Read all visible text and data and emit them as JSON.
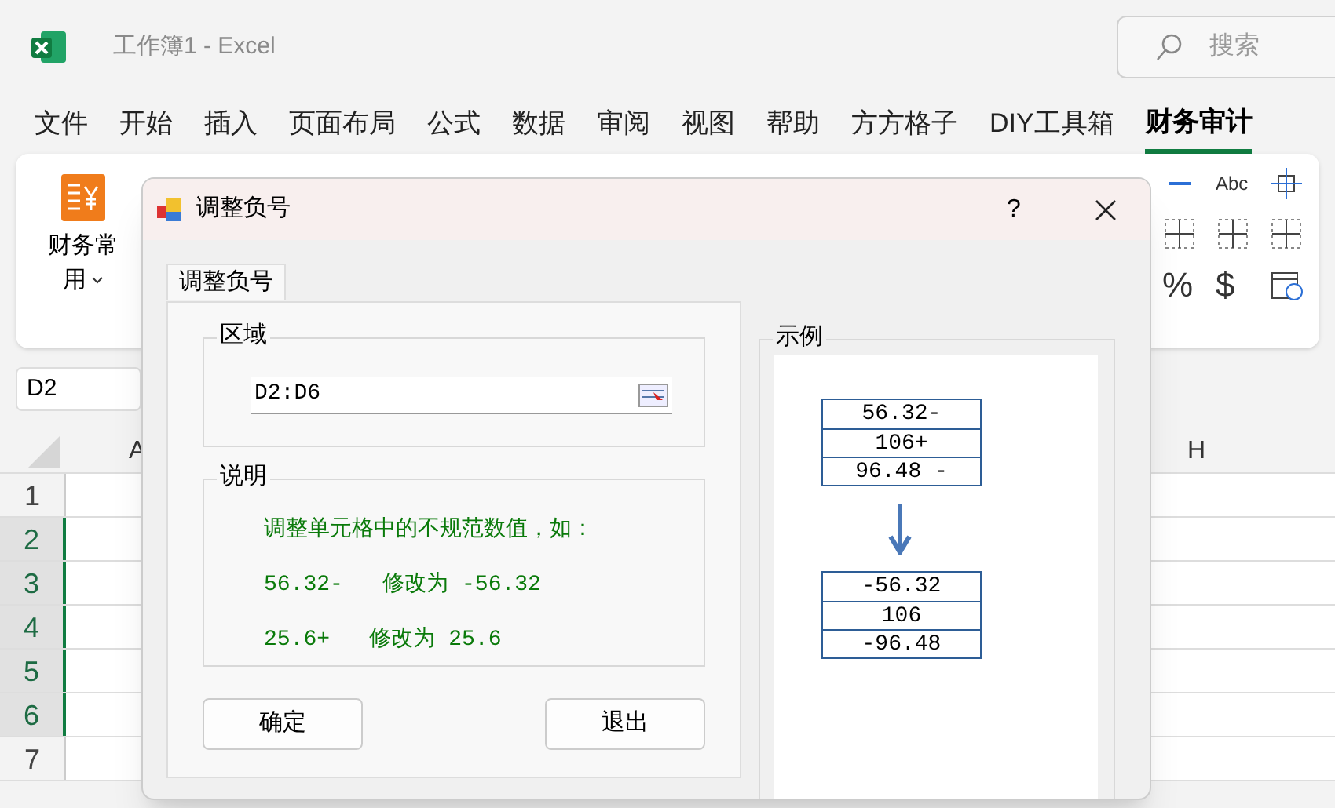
{
  "app": {
    "title": "工作簿1  -  Excel",
    "search_placeholder": "搜索"
  },
  "menu_tabs": [
    {
      "label": "文件",
      "selected": false
    },
    {
      "label": "开始",
      "selected": false
    },
    {
      "label": "插入",
      "selected": false
    },
    {
      "label": "页面布局",
      "selected": false
    },
    {
      "label": "公式",
      "selected": false
    },
    {
      "label": "数据",
      "selected": false
    },
    {
      "label": "审阅",
      "selected": false
    },
    {
      "label": "视图",
      "selected": false
    },
    {
      "label": "帮助",
      "selected": false
    },
    {
      "label": "方方格子",
      "selected": false
    },
    {
      "label": "DIY工具箱",
      "selected": false
    },
    {
      "label": "财务审计",
      "selected": true
    }
  ],
  "ribbon": {
    "main_button": "财务常用",
    "symbols": [
      "Abc",
      "%",
      "$"
    ]
  },
  "name_box": "D2",
  "columns": [
    "A",
    "H"
  ],
  "rows": [
    {
      "label": "1",
      "selected": false
    },
    {
      "label": "2",
      "selected": true
    },
    {
      "label": "3",
      "selected": true
    },
    {
      "label": "4",
      "selected": true
    },
    {
      "label": "5",
      "selected": true
    },
    {
      "label": "6",
      "selected": true
    },
    {
      "label": "7",
      "selected": false
    }
  ],
  "dialog": {
    "title": "调整负号",
    "help": "?",
    "tab": "调整负号",
    "range_group": {
      "title": "区域",
      "value": "D2:D6"
    },
    "note_group": {
      "title": "说明",
      "lines": [
        "调整单元格中的不规范数值，如：",
        "56.32-   修改为 -56.32",
        "25.6+   修改为 25.6"
      ]
    },
    "buttons": [
      "确定",
      "退出"
    ],
    "example": {
      "title": "示例",
      "before": [
        "56.32-",
        "106+",
        "96.48 -"
      ],
      "after": [
        "-56.32",
        "106",
        "-96.48"
      ]
    }
  }
}
